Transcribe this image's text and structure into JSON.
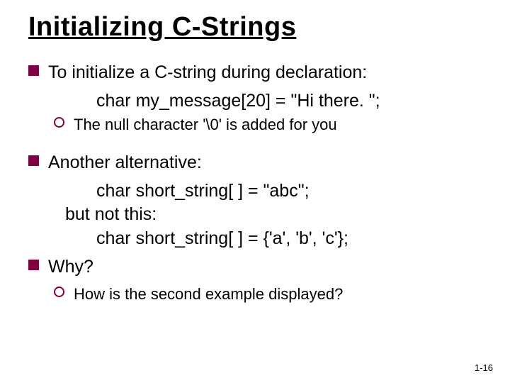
{
  "title": "Initializing C-Strings",
  "b1": {
    "text": "To initialize a C-string during declaration:",
    "code": "char my_message[20] = \"Hi there. \";",
    "sub": "The null character '\\0' is added for you"
  },
  "b2": {
    "text": "Another alternative:",
    "code1": "char short_string[ ] = \"abc\";",
    "mid": "but not this:",
    "code2": "char short_string[ ] = {'a', 'b', 'c'};"
  },
  "b3": {
    "text": "Why?",
    "sub": "How is the second example displayed?"
  },
  "footer": "1-16"
}
